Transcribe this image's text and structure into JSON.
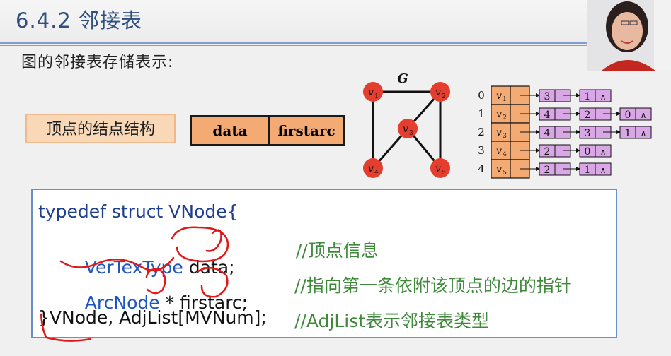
{
  "slide": {
    "title": "6.4.2 邻接表",
    "subtitle": "图的邻接表存储表示:",
    "node_structure_label": "顶点的结点结构",
    "struct_fields": [
      "data",
      "firstarc"
    ]
  },
  "graph": {
    "label": "G",
    "vertices": [
      {
        "base": "v",
        "sub": "1"
      },
      {
        "base": "v",
        "sub": "2"
      },
      {
        "base": "v",
        "sub": "3"
      },
      {
        "base": "v",
        "sub": "4"
      },
      {
        "base": "v",
        "sub": "5"
      }
    ],
    "edges": [
      [
        "v1",
        "v2"
      ],
      [
        "v1",
        "v4"
      ],
      [
        "v2",
        "v3"
      ],
      [
        "v2",
        "v5"
      ],
      [
        "v3",
        "v4"
      ],
      [
        "v3",
        "v5"
      ]
    ]
  },
  "adjacency_list": {
    "rows": [
      {
        "index": "0",
        "vertex_base": "v",
        "vertex_sub": "1",
        "arcs": [
          "3",
          "1"
        ]
      },
      {
        "index": "1",
        "vertex_base": "v",
        "vertex_sub": "2",
        "arcs": [
          "4",
          "2",
          "0"
        ]
      },
      {
        "index": "2",
        "vertex_base": "v",
        "vertex_sub": "3",
        "arcs": [
          "4",
          "3",
          "1"
        ]
      },
      {
        "index": "3",
        "vertex_base": "v",
        "vertex_sub": "4",
        "arcs": [
          "2",
          "0"
        ]
      },
      {
        "index": "4",
        "vertex_base": "v",
        "vertex_sub": "5",
        "arcs": [
          "2",
          "1"
        ]
      }
    ],
    "null_symbol": "∧"
  },
  "code": {
    "line1": "typedef struct VNode{",
    "line2_type": "VerTexType",
    "line2_rest": " data;",
    "line2_comment": "//顶点信息",
    "line3_type": "ArcNode",
    "line3_rest": " * firstarc;",
    "line3_comment": "//指向第一条依附该顶点的边的指针",
    "line4_code": "}VNode, AdjList[MVNum];",
    "line4_comment": "//AdjList表示邻接表类型"
  },
  "colors": {
    "title": "#2f4f7f",
    "vertex_fill": "#e53d2e",
    "adj_head_fill": "#f4aa73",
    "arc_node_fill": "#d9a6e6",
    "code_keyword": "#1f3f90",
    "code_comment": "#3f8a3a",
    "annotation_red": "#e01818"
  }
}
